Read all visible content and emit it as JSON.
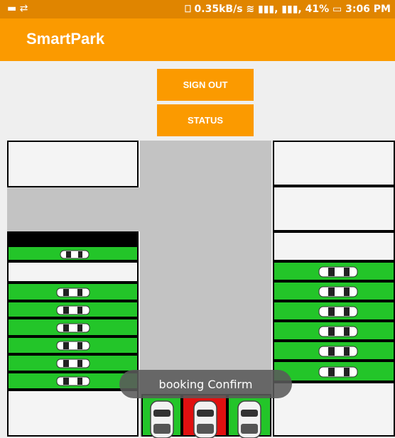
{
  "status_bar": {
    "left_icons": "▬ ⇄",
    "info": "⎕ 0.35kB/s ≋ ▮▮▮, ▮▮▮, 41% ▭ 3:06 PM"
  },
  "app": {
    "title": "SmartPark"
  },
  "buttons": {
    "sign_out": "SIGN OUT",
    "status": "STATUS"
  },
  "toast": "booking Confirm",
  "colors": {
    "accent": "#fb9a00",
    "occupied": "#23c529",
    "booked": "#e11010",
    "road": "#c3c3c3"
  },
  "parking": {
    "left_column": [
      "empty",
      "blocked",
      "occupied",
      "empty",
      "occupied",
      "occupied",
      "occupied",
      "occupied",
      "occupied",
      "occupied",
      "empty"
    ],
    "right_column": [
      "empty",
      "empty",
      "empty",
      "occupied",
      "occupied",
      "occupied",
      "occupied",
      "occupied",
      "occupied",
      "empty"
    ],
    "bottom_row": [
      "occupied",
      "booked",
      "occupied"
    ]
  }
}
